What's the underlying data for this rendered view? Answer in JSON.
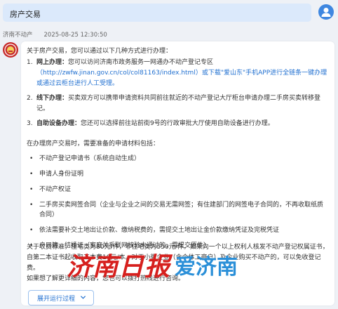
{
  "user_message": "房产交易",
  "bot": {
    "name": "济南不动产",
    "timestamp": "2025-08-25 12:30:50"
  },
  "answer": {
    "intro": "关于房产交易，您可以通过以下几种方式进行办理：",
    "methods": [
      {
        "num": "1.",
        "title": "网上办理：",
        "text": "您可以访问济南市政务服务一网通办不动产登记专区",
        "link": "（http://zwfw.jinan.gov.cn/col/col81163/index.html）或下载\"爱山东\"手机APP进行全链条一键办理或通过云柜台进行人工受理。"
      },
      {
        "num": "2.",
        "title": "线下办理：",
        "text": "买卖双方可以携带申请资料共同前往就近的不动产登记大厅柜台申请办理二手房买卖转移登记。",
        "link": ""
      },
      {
        "num": "3.",
        "title": "自助设备办理：",
        "text": "您还可以选择前往站前街9号的行政审批大厅使用自助设备进行办理。",
        "link": ""
      }
    ],
    "materials_intro": "在办理房产交易时，需要准备的申请材料包括：",
    "materials": [
      "不动产登记申请书（系统自动生成）",
      "申请人身份证明",
      "不动产权证",
      "二手房买卖网签合同（企业与企业之间的交易无需网签；有住建部门的网签电子合同的，不再收取纸质合同）",
      "依法需要补交土地出让价款、缴纳税费的，需提交土地出让金价款缴纳凭证及完税凭证",
      "户口簿、结婚证（家庭关系联网核验未通过的，需提交原件）"
    ],
    "fees": "关于收费标准，住宅类为80元/件，非住宅类为550元/件。如果向一个以上权利人核发不动产登记权属证书，自第二本证书起收取工本费10元/本。对于小微企业（含个体工商户）及企业购买不动产的，可以免收登记费。",
    "outro": "如果想了解更详细的内容，您也可以拨打热线进行咨询。",
    "expand_button": "展开运行过程"
  },
  "watermark": {
    "part1": "济南日报",
    "part2": "爱济南"
  },
  "colors": {
    "user_bubble": "#dbe9fb",
    "link": "#1f6fd0",
    "watermark_red": "#d6201e",
    "watermark_blue": "#2a8fd8"
  }
}
